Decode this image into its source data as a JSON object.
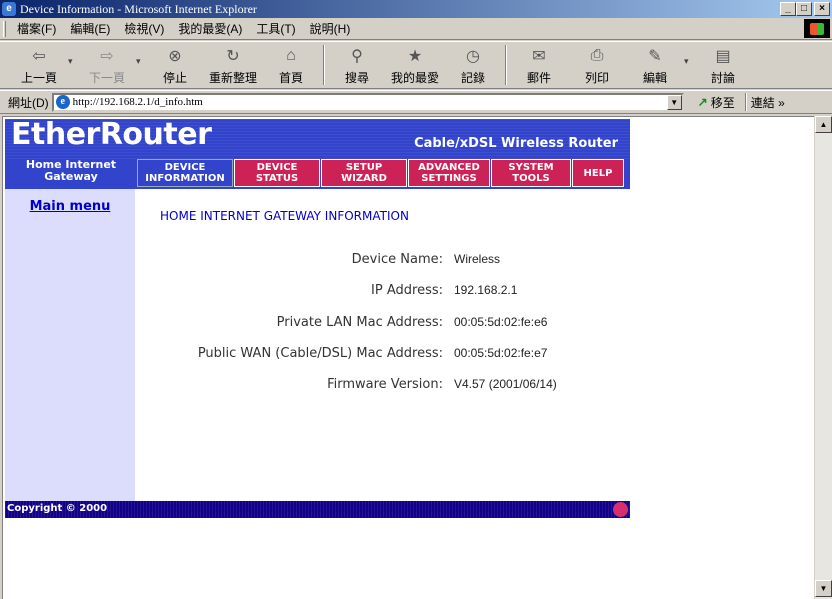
{
  "window": {
    "title": "Device Information - Microsoft Internet Explorer",
    "buttons": [
      "_",
      "□",
      "×"
    ]
  },
  "menubar": {
    "items": [
      "檔案(F)",
      "編輯(E)",
      "檢視(V)",
      "我的最愛(A)",
      "工具(T)",
      "說明(H)"
    ]
  },
  "toolbar": {
    "back": "上一頁",
    "forward": "下一頁",
    "stop": "停止",
    "refresh": "重新整理",
    "home": "首頁",
    "search": "搜尋",
    "favorites": "我的最愛",
    "history": "記錄",
    "mail": "郵件",
    "print": "列印",
    "edit": "編輯",
    "discuss": "討論"
  },
  "addressbar": {
    "label": "網址(D)",
    "url": "http://192.168.2.1/d_info.htm",
    "go_label": "移至",
    "links_label": "連結 »"
  },
  "router": {
    "brand": "EtherRouter",
    "subbrand": "Cable/xDSL Wireless Router",
    "gateway_label": "Home Internet Gateway",
    "nav": [
      {
        "line1": "DEVICE",
        "line2": "INFORMATION"
      },
      {
        "line1": "DEVICE",
        "line2": "STATUS"
      },
      {
        "line1": "SETUP",
        "line2": "WIZARD"
      },
      {
        "line1": "ADVANCED",
        "line2": "SETTINGS"
      },
      {
        "line1": "SYSTEM",
        "line2": "TOOLS"
      },
      {
        "line1": "HELP",
        "line2": ""
      }
    ],
    "main_menu": "Main menu",
    "page_title": "HOME INTERNET GATEWAY INFORMATION",
    "info": [
      {
        "label": "Device Name:",
        "value": "Wireless"
      },
      {
        "label": "IP Address:",
        "value": "192.168.2.1"
      },
      {
        "label": "Private LAN Mac Address:",
        "value": "00:05:5d:02:fe:e6"
      },
      {
        "label": "Public WAN (Cable/DSL) Mac Address:",
        "value": "00:05:5d:02:fe:e7"
      },
      {
        "label": "Firmware Version:",
        "value": "V4.57 (2001/06/14)"
      }
    ],
    "copyright": "Copyright © 2000"
  },
  "colors": {
    "banner_blue": "#3344cc",
    "tab_pink": "#cc2255",
    "sidebar_lavender": "#dcdcfc",
    "footer_navy": "#110088",
    "link_blue": "#0000cc"
  }
}
